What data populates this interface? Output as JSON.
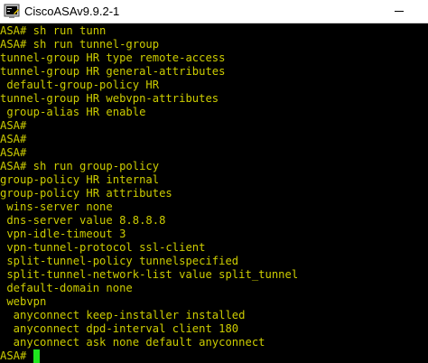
{
  "window": {
    "title": "CiscoASAv9.9.2-1",
    "icon": "putty-terminal-icon"
  },
  "colors": {
    "terminal_background": "#000000",
    "terminal_text": "#cccc00",
    "cursor": "#1ee61e",
    "titlebar_background": "#ffffff"
  },
  "terminal": {
    "lines": [
      "ASA# sh run tunn",
      "ASA# sh run tunnel-group",
      "tunnel-group HR type remote-access",
      "tunnel-group HR general-attributes",
      " default-group-policy HR",
      "tunnel-group HR webvpn-attributes",
      " group-alias HR enable",
      "ASA#",
      "ASA#",
      "ASA#",
      "ASA# sh run group-policy",
      "group-policy HR internal",
      "group-policy HR attributes",
      " wins-server none",
      " dns-server value 8.8.8.8",
      " vpn-idle-timeout 3",
      " vpn-tunnel-protocol ssl-client",
      " split-tunnel-policy tunnelspecified",
      " split-tunnel-network-list value split_tunnel",
      " default-domain none",
      " webvpn",
      "  anyconnect keep-installer installed",
      "  anyconnect dpd-interval client 180",
      "  anyconnect ask none default anyconnect"
    ],
    "current_prompt": "ASA# "
  }
}
